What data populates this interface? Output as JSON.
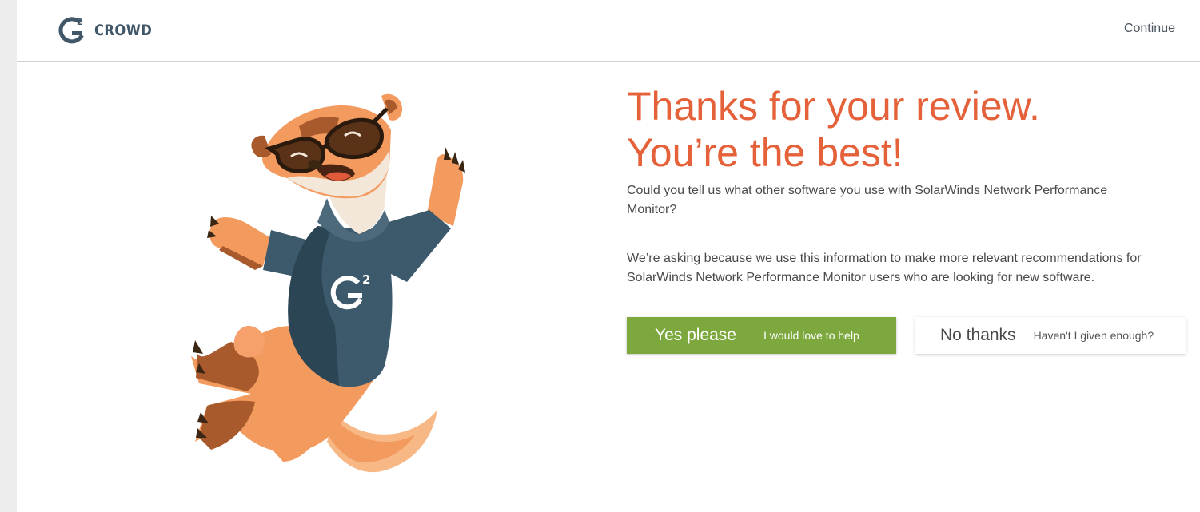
{
  "header": {
    "logo_text": "CROWD",
    "logo_mark": "g2-logo-icon",
    "continue_label": "Continue"
  },
  "hero": {
    "mascot": "g2-mascot-illustration",
    "shirt_logo": "g2-logo-icon"
  },
  "content": {
    "title_line1": "Thanks for your review.",
    "title_line2": "You’re the best!",
    "question": "Could you tell us what other software you use with SolarWinds Network Performance Monitor?",
    "reason": "We’re asking because we use this information to make more relevant recommendations for SolarWinds Network Performance Monitor users who are looking for new software."
  },
  "actions": {
    "yes": {
      "label": "Yes please",
      "sublabel": "I would love to help"
    },
    "no": {
      "label": "No thanks",
      "sublabel": "Haven't I given enough?"
    }
  },
  "colors": {
    "accent": "#e5613a",
    "yes_button": "#7da83e",
    "brand_slate": "#3f5769"
  }
}
